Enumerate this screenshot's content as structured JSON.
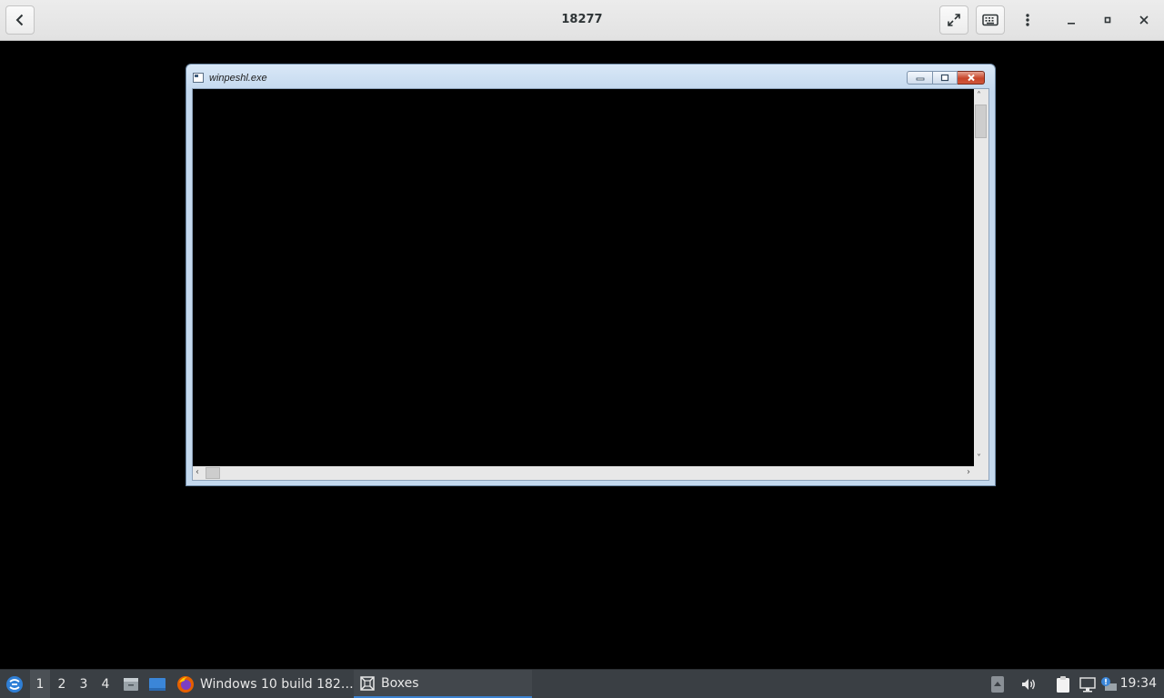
{
  "header": {
    "title": "18277",
    "back_icon": "chevron-left-icon",
    "fullscreen_icon": "expand-icon",
    "keyboard_icon": "keyboard-icon",
    "menu_icon": "vertical-dots-icon",
    "minimize_icon": "minimize-icon",
    "maximize_icon": "maximize-icon",
    "close_icon": "close-icon"
  },
  "guest_window": {
    "title": "winpeshl.exe",
    "content_background": "#000000"
  },
  "taskbar": {
    "workspaces": [
      "1",
      "2",
      "3",
      "4"
    ],
    "active_workspace": "1",
    "tasks": [
      {
        "label": "Windows 10 build 182…",
        "icon": "firefox-icon"
      },
      {
        "label": "Boxes",
        "icon": "boxes-icon",
        "active": true
      }
    ],
    "clock": "19:34",
    "accent": "#3b82d0"
  }
}
